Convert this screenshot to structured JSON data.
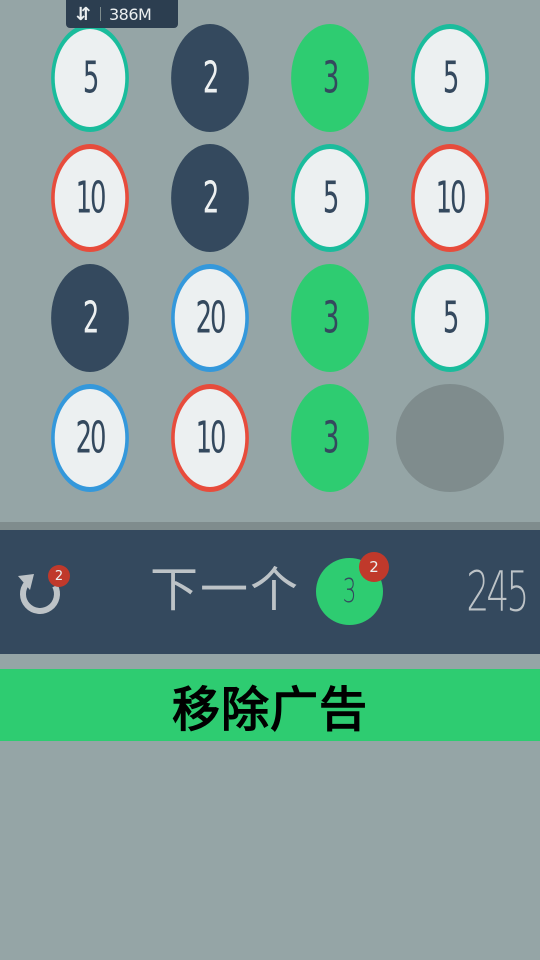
{
  "status": {
    "arrows_icon": "up-down-arrows-icon",
    "memory": "386M"
  },
  "board": {
    "rows": [
      [
        {
          "value": "5",
          "style": "teal"
        },
        {
          "value": "2",
          "style": "navy"
        },
        {
          "value": "3",
          "style": "green"
        },
        {
          "value": "5",
          "style": "teal"
        }
      ],
      [
        {
          "value": "10",
          "style": "red"
        },
        {
          "value": "2",
          "style": "navy"
        },
        {
          "value": "5",
          "style": "teal"
        },
        {
          "value": "10",
          "style": "red"
        }
      ],
      [
        {
          "value": "2",
          "style": "navy"
        },
        {
          "value": "20",
          "style": "blue"
        },
        {
          "value": "3",
          "style": "green"
        },
        {
          "value": "5",
          "style": "teal"
        }
      ],
      [
        {
          "value": "20",
          "style": "blue"
        },
        {
          "value": "10",
          "style": "red"
        },
        {
          "value": "3",
          "style": "green"
        },
        {
          "value": "",
          "style": "empty"
        }
      ]
    ]
  },
  "hud": {
    "undo_icon": "undo-arrow-icon",
    "undo_count": "2",
    "next_label": "下一个",
    "next_value": "3",
    "next_count": "2",
    "score": "245"
  },
  "ads": {
    "remove_ads_label": "移除广告"
  },
  "colors": {
    "background": "#95a5a6",
    "navy": "#34495e",
    "green": "#2ecc71",
    "teal": "#1abc9c",
    "red": "#e74c3c",
    "blue": "#3498db",
    "tile_white": "#ecf0f1",
    "badge_red": "#c0392b"
  }
}
